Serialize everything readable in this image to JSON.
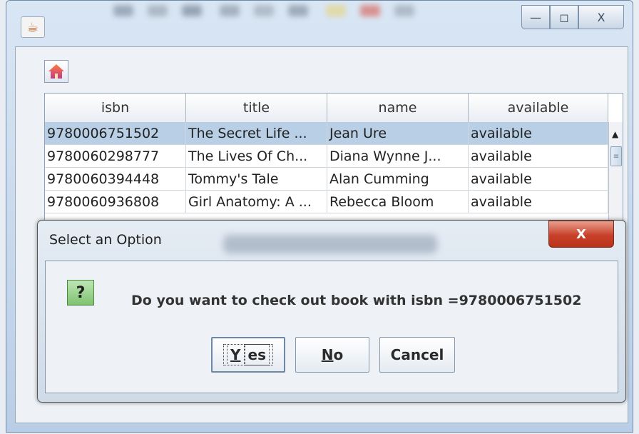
{
  "window": {
    "controls": {
      "minimize_glyph": "—",
      "maximize_glyph": "◻",
      "close_glyph": "X"
    }
  },
  "toolbar": {
    "home_icon": "home-icon"
  },
  "table": {
    "columns": [
      "isbn",
      "title",
      "name",
      "available"
    ],
    "rows": [
      {
        "isbn": "9780006751502",
        "title": "The Secret Life ...",
        "name": "Jean Ure",
        "available": "available",
        "selected": true
      },
      {
        "isbn": "9780060298777",
        "title": "The Lives Of Ch...",
        "name": "Diana Wynne J...",
        "available": "available",
        "selected": false
      },
      {
        "isbn": "9780060394448",
        "title": "Tommy's Tale",
        "name": "Alan Cumming",
        "available": "available",
        "selected": false
      },
      {
        "isbn": "9780060936808",
        "title": "Girl Anatomy: A ...",
        "name": "Rebecca Bloom",
        "available": "available",
        "selected": false
      }
    ],
    "selection_color": "#b8cfe5"
  },
  "dialog": {
    "title": "Select an Option",
    "close_glyph": "X",
    "icon_glyph": "?",
    "message": "Do you want to check out book with isbn =9780006751502",
    "buttons": {
      "yes": {
        "mnemonic": "Y",
        "rest": "es"
      },
      "no": {
        "mnemonic": "N",
        "rest": "o"
      },
      "cancel": "Cancel"
    }
  }
}
